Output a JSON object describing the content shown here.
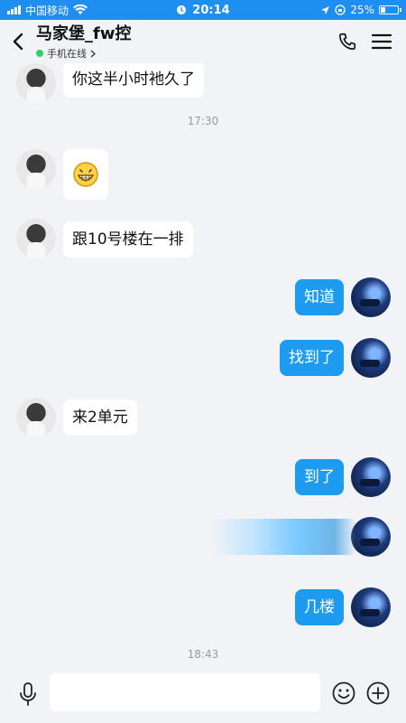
{
  "status_bar": {
    "carrier": "中国移动",
    "time": "20:14",
    "battery": "25%"
  },
  "header": {
    "title": "马家堡_fw控",
    "status": "手机在线"
  },
  "messages": [
    {
      "side": "left",
      "text": "你这半小时衪久了"
    },
    {
      "timestamp": "17:30"
    },
    {
      "side": "left",
      "text": "😁"
    },
    {
      "side": "left",
      "text": "跟10号楼在一排"
    },
    {
      "side": "right",
      "text": "知道"
    },
    {
      "side": "right",
      "text": "找到了"
    },
    {
      "side": "left",
      "text": "来2单元"
    },
    {
      "side": "right",
      "text": "到了"
    },
    {
      "side": "right",
      "text": ""
    },
    {
      "side": "right",
      "text": "几楼"
    },
    {
      "timestamp": "18:43"
    }
  ],
  "input": {
    "value": "",
    "placeholder": ""
  },
  "colors": {
    "accent": "#1d9bf0",
    "status_bar": "#1f8ef1",
    "background": "#f2f3f7",
    "online": "#2bd46a"
  },
  "icons": [
    "back-icon",
    "phone-icon",
    "menu-icon",
    "microphone-icon",
    "emoji-icon",
    "plus-icon"
  ]
}
